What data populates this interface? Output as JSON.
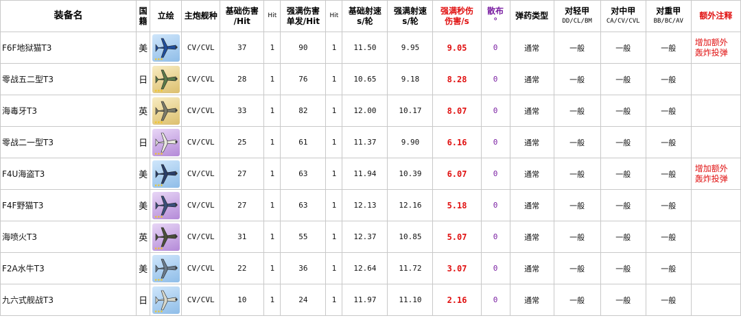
{
  "header": {
    "name": "装备名",
    "country": "国籍",
    "portrait": "立绘",
    "ship_type": "主炮舰种",
    "base_dmg": [
      "基础伤害",
      "/Hit"
    ],
    "hit_a": "Hit",
    "max_dmg": [
      "强满伤害",
      "单发/Hit"
    ],
    "hit_b": "Hit",
    "base_rate": [
      "基础射速",
      "s/轮"
    ],
    "max_rate": [
      "强满射速",
      "s/轮"
    ],
    "dps": [
      "强满秒伤",
      "伤害/s"
    ],
    "spread": [
      "散布",
      "°"
    ],
    "ammo": "弹药类型",
    "light": [
      "对轻甲",
      "DD/CL/BM"
    ],
    "medium": [
      "对中甲",
      "CA/CV/CVL"
    ],
    "heavy": [
      "对重甲",
      "BB/BC/AV"
    ],
    "note": "额外注释"
  },
  "colors": {
    "dps_red": "#e01010",
    "spread_purple": "#7a1fa2",
    "border": "#c8c8c8"
  },
  "rows": [
    {
      "name": "F6F地狱猫T3",
      "country": "美",
      "rarity": "blue",
      "plane": "#1f4e9c",
      "ship": "CV/CVL",
      "base_dmg": "37",
      "hit_a": "1",
      "max_dmg": "90",
      "hit_b": "1",
      "base_rate": "11.50",
      "max_rate": "9.95",
      "dps": "9.05",
      "spread": "0",
      "ammo": "通常",
      "light": "一般",
      "medium": "一般",
      "heavy": "一般",
      "note": [
        "增加额外",
        "轰炸投弹"
      ]
    },
    {
      "name": "零战五二型T3",
      "country": "日",
      "rarity": "gold",
      "plane": "#5a7a4a",
      "ship": "CV/CVL",
      "base_dmg": "28",
      "hit_a": "1",
      "max_dmg": "76",
      "hit_b": "1",
      "base_rate": "10.65",
      "max_rate": "9.18",
      "dps": "8.28",
      "spread": "0",
      "ammo": "通常",
      "light": "一般",
      "medium": "一般",
      "heavy": "一般",
      "note": [
        "",
        ""
      ]
    },
    {
      "name": "海毒牙T3",
      "country": "英",
      "rarity": "gold",
      "plane": "#7a7a6a",
      "ship": "CV/CVL",
      "base_dmg": "33",
      "hit_a": "1",
      "max_dmg": "82",
      "hit_b": "1",
      "base_rate": "12.00",
      "max_rate": "10.17",
      "dps": "8.07",
      "spread": "0",
      "ammo": "通常",
      "light": "一般",
      "medium": "一般",
      "heavy": "一般",
      "note": [
        "",
        ""
      ]
    },
    {
      "name": "零战二一型T3",
      "country": "日",
      "rarity": "purple",
      "plane": "#e8e8e0",
      "ship": "CV/CVL",
      "base_dmg": "25",
      "hit_a": "1",
      "max_dmg": "61",
      "hit_b": "1",
      "base_rate": "11.37",
      "max_rate": "9.90",
      "dps": "6.16",
      "spread": "0",
      "ammo": "通常",
      "light": "一般",
      "medium": "一般",
      "heavy": "一般",
      "note": [
        "",
        ""
      ]
    },
    {
      "name": "F4U海盗T3",
      "country": "美",
      "rarity": "blue",
      "plane": "#2a3f6a",
      "ship": "CV/CVL",
      "base_dmg": "27",
      "hit_a": "1",
      "max_dmg": "63",
      "hit_b": "1",
      "base_rate": "11.94",
      "max_rate": "10.39",
      "dps": "6.07",
      "spread": "0",
      "ammo": "通常",
      "light": "一般",
      "medium": "一般",
      "heavy": "一般",
      "note": [
        "增加额外",
        "轰炸投弹"
      ]
    },
    {
      "name": "F4F野猫T3",
      "country": "美",
      "rarity": "purple",
      "plane": "#3a4f7a",
      "ship": "CV/CVL",
      "base_dmg": "27",
      "hit_a": "1",
      "max_dmg": "63",
      "hit_b": "1",
      "base_rate": "12.13",
      "max_rate": "12.16",
      "dps": "5.18",
      "spread": "0",
      "ammo": "通常",
      "light": "一般",
      "medium": "一般",
      "heavy": "一般",
      "note": [
        "",
        ""
      ]
    },
    {
      "name": "海喷火T3",
      "country": "英",
      "rarity": "purple",
      "plane": "#4a4f3a",
      "ship": "CV/CVL",
      "base_dmg": "31",
      "hit_a": "1",
      "max_dmg": "55",
      "hit_b": "1",
      "base_rate": "12.37",
      "max_rate": "10.85",
      "dps": "5.07",
      "spread": "0",
      "ammo": "通常",
      "light": "一般",
      "medium": "一般",
      "heavy": "一般",
      "note": [
        "",
        ""
      ]
    },
    {
      "name": "F2A水牛T3",
      "country": "美",
      "rarity": "blue",
      "plane": "#6a7a8a",
      "ship": "CV/CVL",
      "base_dmg": "22",
      "hit_a": "1",
      "max_dmg": "36",
      "hit_b": "1",
      "base_rate": "12.64",
      "max_rate": "11.72",
      "dps": "3.07",
      "spread": "0",
      "ammo": "通常",
      "light": "一般",
      "medium": "一般",
      "heavy": "一般",
      "note": [
        "",
        ""
      ]
    },
    {
      "name": "九六式舰战T3",
      "country": "日",
      "rarity": "blue",
      "plane": "#d8d8cc",
      "ship": "CV/CVL",
      "base_dmg": "10",
      "hit_a": "1",
      "max_dmg": "24",
      "hit_b": "1",
      "base_rate": "11.97",
      "max_rate": "11.10",
      "dps": "2.16",
      "spread": "0",
      "ammo": "通常",
      "light": "一般",
      "medium": "一般",
      "heavy": "一般",
      "note": [
        "",
        ""
      ]
    }
  ]
}
